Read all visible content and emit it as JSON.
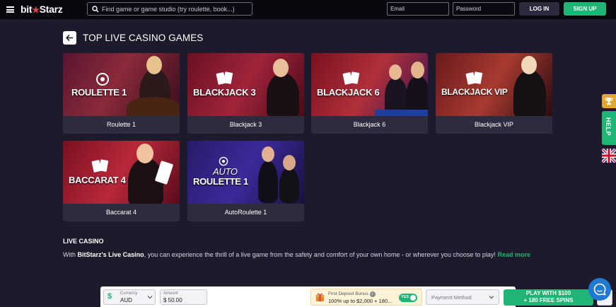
{
  "header": {
    "logo_left": "bit",
    "logo_star": "★",
    "logo_right": "Starz",
    "search_placeholder": "Find game or game studio (try roulette, book...)",
    "email_placeholder": "Email",
    "password_placeholder": "Password",
    "login_label": "LOG IN",
    "signup_label": "SIGN UP"
  },
  "section": {
    "title": "TOP LIVE CASINO GAMES"
  },
  "games": [
    {
      "thumb_title": "ROULETTE 1",
      "caption": "Roulette 1"
    },
    {
      "thumb_title": "BLACKJACK 3",
      "caption": "Blackjack 3"
    },
    {
      "thumb_title": "BLACKJACK 6",
      "caption": "Blackjack 6"
    },
    {
      "thumb_title": "BLACKJACK VIP",
      "caption": "Blackjack VIP"
    },
    {
      "thumb_title": "BACCARAT 4",
      "caption": "Baccarat 4"
    },
    {
      "thumb_title_top": "AUTO",
      "thumb_title": "ROULETTE 1",
      "caption": "AutoRoulette 1"
    }
  ],
  "about": {
    "title": "LIVE CASINO",
    "text_start": "With ",
    "text_bold": "BitStarz's Live Casino",
    "text_rest": ", you can experience the thrill of a live game from the safety and comfort of your own home - or wherever you choose to play! ",
    "read_more": "Read more"
  },
  "side_tabs": {
    "help_label": "HELP",
    "trophy_icon": "trophy-icon",
    "flag_icon": "uk-flag-icon"
  },
  "deposit_bar": {
    "currency_label": "Currency",
    "currency_value": "AUD",
    "currency_symbol": "$",
    "amount_label": "Amount",
    "amount_value": "$ 50.00",
    "bonus_label": "First Deposit Bonus",
    "bonus_info": "i",
    "bonus_value": "100% up to $2,000 + 180...",
    "toggle_label": "YES",
    "payment_placeholder": "Payment Method",
    "play_line1": "PLAY WITH $100",
    "play_line2": "+ 180 FREE SPINS",
    "close_label": "✕"
  },
  "colors": {
    "background": "#1c1a2b",
    "topbar": "#09080f",
    "card": "#2d2b3e",
    "accent_green": "#1fb575",
    "logo_red": "#e04548",
    "trophy_gold": "#e0a82e",
    "chat_blue": "#1f78d1"
  }
}
